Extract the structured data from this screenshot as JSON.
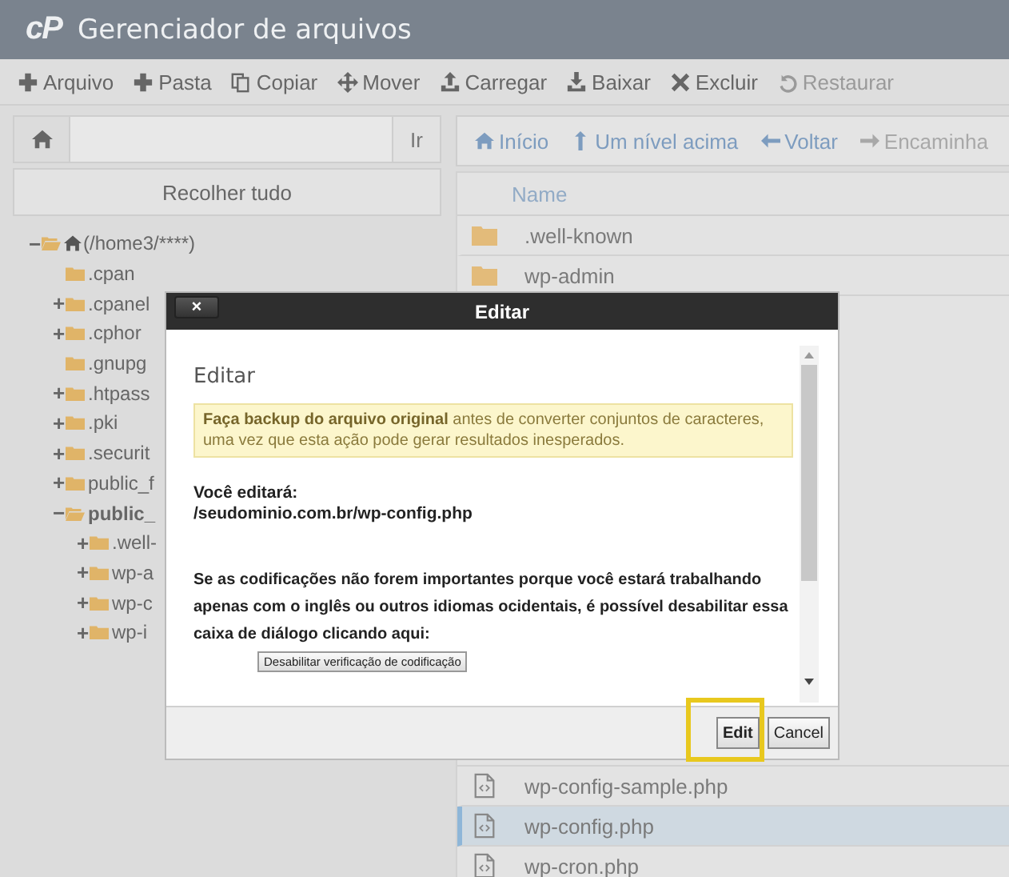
{
  "app": {
    "logo": "cP",
    "title": "Gerenciador de arquivos"
  },
  "toolbar": [
    {
      "label": "Arquivo",
      "disabled": false
    },
    {
      "label": "Pasta",
      "disabled": false
    },
    {
      "label": "Copiar",
      "disabled": false
    },
    {
      "label": "Mover",
      "disabled": false
    },
    {
      "label": "Carregar",
      "disabled": false
    },
    {
      "label": "Baixar",
      "disabled": false
    },
    {
      "label": "Excluir",
      "disabled": false
    },
    {
      "label": "Restaurar",
      "disabled": true
    }
  ],
  "path_bar": {
    "button": "Ir"
  },
  "collapse_button": "Recolher tudo",
  "tree": [
    {
      "label": "(/home3/****)",
      "kind": "home",
      "toggle": "−",
      "expanded": true,
      "selected": false,
      "children": [
        {
          "label": ".cpan",
          "kind": "folder",
          "expanded": false,
          "selected": false
        },
        {
          "label": ".cpanel",
          "kind": "folder",
          "toggle": "+",
          "expanded": false,
          "selected": false
        },
        {
          "label": ".cphor",
          "kind": "folder",
          "toggle": "+",
          "expanded": false,
          "selected": false
        },
        {
          "label": ".gnupg",
          "kind": "folder",
          "expanded": false,
          "selected": false
        },
        {
          "label": ".htpass",
          "kind": "folder",
          "toggle": "+",
          "expanded": false,
          "selected": false
        },
        {
          "label": ".pki",
          "kind": "folder",
          "toggle": "+",
          "expanded": false,
          "selected": false
        },
        {
          "label": ".securit",
          "kind": "folder",
          "toggle": "+",
          "expanded": false,
          "selected": false
        },
        {
          "label": "public_f",
          "kind": "folder",
          "toggle": "+",
          "expanded": false,
          "selected": false
        },
        {
          "label": "public_",
          "kind": "folder",
          "toggle": "−",
          "expanded": true,
          "selected": true,
          "children": [
            {
              "label": ".well-",
              "kind": "folder",
              "toggle": "+",
              "expanded": false,
              "selected": false
            },
            {
              "label": "wp-a",
              "kind": "folder",
              "toggle": "+",
              "expanded": false,
              "selected": false
            },
            {
              "label": "wp-c",
              "kind": "folder",
              "toggle": "+",
              "expanded": false,
              "selected": false
            },
            {
              "label": "wp-i",
              "kind": "folder",
              "toggle": "+",
              "expanded": false,
              "selected": false
            }
          ]
        }
      ]
    }
  ],
  "nav": [
    "Início",
    "Um nível acima",
    "Voltar",
    "Encaminha"
  ],
  "file_table": {
    "columns": [
      "Name"
    ],
    "rows": [
      {
        "name": ".well-known",
        "kind": "folder",
        "selected": false
      },
      {
        "name": "wp-admin",
        "kind": "folder",
        "selected": false
      },
      {
        "name": "wp-config-sample.php",
        "kind": "file",
        "selected": false
      },
      {
        "name": "wp-config.php",
        "kind": "file",
        "selected": true
      },
      {
        "name": "wp-cron.php",
        "kind": "file",
        "selected": false
      }
    ]
  },
  "dialog": {
    "title": "Editar",
    "close": "×",
    "heading": "Editar",
    "warning": "**Faça backup do arquivo original** antes de converter conjuntos de caracteres, uma vez que esta ação pode gerar resultados inesperados.",
    "target_label": "Você editará:",
    "target_path": "/seudominio.com.br/wp-config.php",
    "info": "Se as codificações não forem importantes porque você estará trabalhando apenas com o inglês ou outros idiomas ocidentais, é possível desabilitar essa caixa de diálogo clicando aqui:",
    "disable_button": "Desabilitar verificação de codificação",
    "buttons": [
      {
        "label": "Edit",
        "highlighted": true
      },
      {
        "label": "Cancel",
        "highlighted": false
      }
    ]
  }
}
